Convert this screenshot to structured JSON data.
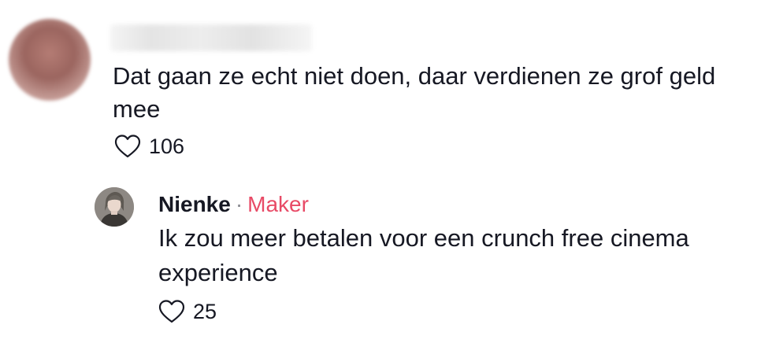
{
  "comment": {
    "text": "Dat gaan ze echt niet doen, daar verdienen ze grof geld mee",
    "like_count": "106"
  },
  "reply": {
    "author": "Nienke",
    "separator": "·",
    "badge": "Maker",
    "text": "Ik zou meer betalen voor een crunch free cinema experience",
    "like_count": "25"
  },
  "icons": {
    "like": "heart-outline-icon"
  },
  "colors": {
    "text": "#161823",
    "creator_badge": "#e84a66",
    "muted": "#8a8b91",
    "background": "#ffffff"
  }
}
